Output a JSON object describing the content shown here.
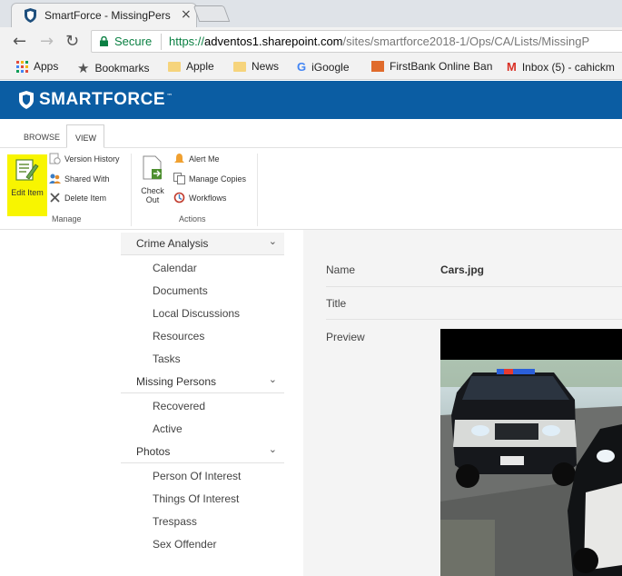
{
  "browser": {
    "tab_title": "SmartForce - MissingPers",
    "tab_close": "×",
    "secure_label": "Secure",
    "url_scheme": "https://",
    "url_host": "adventos1.sharepoint.com",
    "url_path": "/sites/smartforce2018-1/Ops/CA/Lists/MissingP"
  },
  "bookmarks": [
    {
      "label": "Apps",
      "icon": "apps-grid-icon"
    },
    {
      "label": "Bookmarks",
      "icon": "star-icon"
    },
    {
      "label": "Apple",
      "icon": "folder-icon"
    },
    {
      "label": "News",
      "icon": "folder-icon"
    },
    {
      "label": "iGoogle",
      "icon": "google-icon"
    },
    {
      "label": "FirstBank Online Ban",
      "icon": "firstbank-icon"
    },
    {
      "label": "Inbox (5) - cahickm",
      "icon": "gmail-icon"
    }
  ],
  "site": {
    "brand": "SMARTFORCE",
    "tm": "™",
    "header_color": "#0b5da3"
  },
  "ribbon": {
    "tabs": [
      "BROWSE",
      "VIEW"
    ],
    "edit_item": "Edit Item",
    "version_history": "Version History",
    "shared_with": "Shared With",
    "delete_item": "Delete Item",
    "manage_group": "Manage",
    "check_out": "Check Out",
    "alert_me": "Alert Me",
    "manage_copies": "Manage Copies",
    "workflows": "Workflows",
    "actions_group": "Actions",
    "highlight_color": "#f8f500"
  },
  "quicklaunch": {
    "sections": [
      {
        "title": "Crime Analysis",
        "items": [
          "Calendar",
          "Documents",
          "Local Discussions",
          "Resources",
          "Tasks"
        ]
      },
      {
        "title": "Missing Persons",
        "items": [
          "Recovered",
          "Active"
        ]
      },
      {
        "title": "Photos",
        "items": [
          "Person Of Interest",
          "Things Of Interest",
          "Trespass",
          "Sex Offender"
        ]
      }
    ]
  },
  "item": {
    "name_label": "Name",
    "name_value": "Cars.jpg",
    "title_label": "Title",
    "title_value": "",
    "preview_label": "Preview"
  }
}
